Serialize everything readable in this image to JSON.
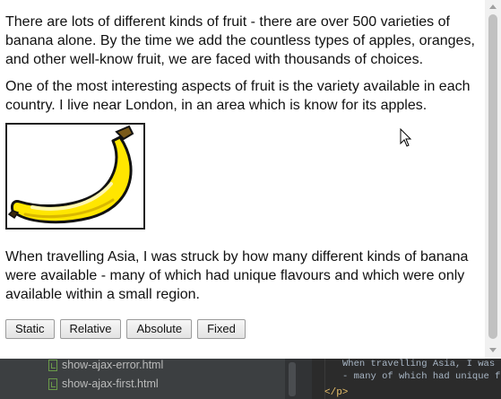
{
  "page": {
    "paragraphs": [
      "There are lots of different kinds of fruit - there are over 500 varieties of banana alone. By the time we add the countless types of apples, oranges, and other well-know fruit, we are faced with thousands of choices.",
      "One of the most interesting aspects of fruit is the variety available in each country. I live near London, in an area which is know for its apples.",
      "When travelling Asia, I was struck by how many different kinds of banana were available - many of which had unique flavours and which were only available within a small region."
    ],
    "image_icon": "banana-image",
    "buttons": [
      "Static",
      "Relative",
      "Absolute",
      "Fixed"
    ]
  },
  "ide": {
    "files": [
      "show-ajax-error.html",
      "show-ajax-first.html"
    ],
    "code_lines": [
      "When travelling Asia, I was s",
      "- many of which had unique fl"
    ],
    "closing_tag": "</p>"
  },
  "colors": {
    "banana_fill": "#ffe600",
    "banana_outline": "#111111",
    "file_icon": "#6a9a4a",
    "code_text": "#a9b7c6",
    "code_tag": "#e8bf6a"
  }
}
